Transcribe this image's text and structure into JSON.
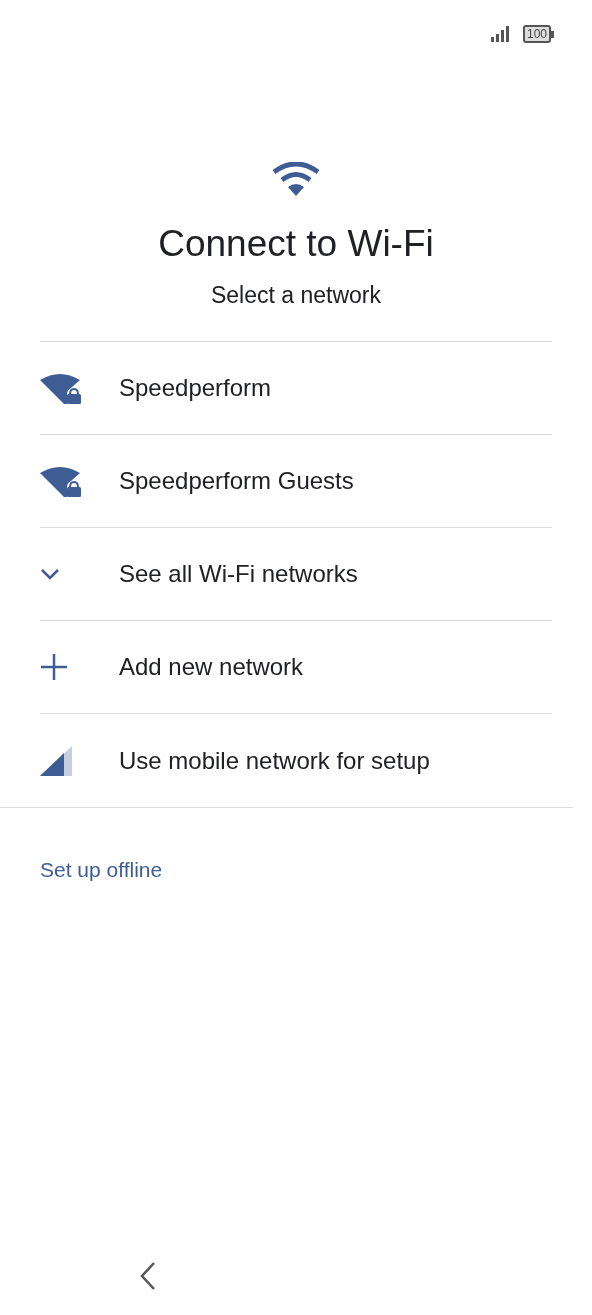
{
  "status_bar": {
    "battery": "100"
  },
  "header": {
    "title": "Connect to Wi-Fi",
    "subtitle": "Select a network"
  },
  "items": [
    {
      "kind": "wifi_locked",
      "label": "Speedperform"
    },
    {
      "kind": "wifi_locked",
      "label": "Speedperform Guests"
    },
    {
      "kind": "expand",
      "label": "See all Wi-Fi networks"
    },
    {
      "kind": "add",
      "label": "Add new network"
    },
    {
      "kind": "mobile",
      "label": "Use mobile network for setup"
    }
  ],
  "offline_link": "Set up offline"
}
